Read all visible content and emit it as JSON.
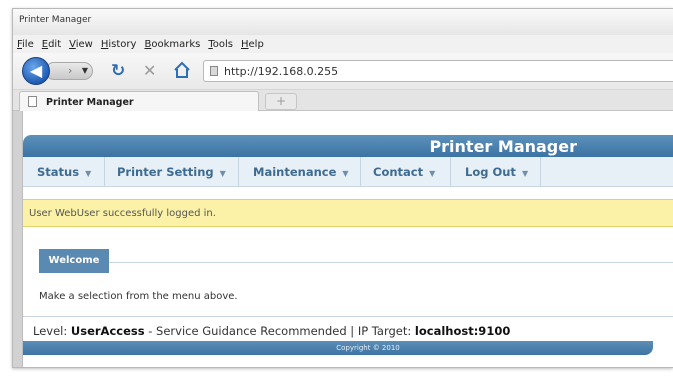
{
  "window": {
    "title": "Printer Manager"
  },
  "menubar": {
    "items": [
      "File",
      "Edit",
      "View",
      "History",
      "Bookmarks",
      "Tools",
      "Help"
    ]
  },
  "navbar": {
    "url": "http://192.168.0.255"
  },
  "tab": {
    "title": "Printer Manager",
    "new_tab": "+"
  },
  "page": {
    "header_title": "Printer Manager",
    "menu": [
      {
        "label": "Status"
      },
      {
        "label": "Printer Setting"
      },
      {
        "label": "Maintenance"
      },
      {
        "label": "Contact"
      },
      {
        "label": "Log Out"
      }
    ],
    "notice": "User WebUser successfully logged in.",
    "welcome_tab": "Welcome",
    "welcome_text": "Make a selection from the menu above.",
    "status": {
      "level_label": "Level:",
      "level_value": "UserAccess",
      "guidance": " - Service Guidance Recommended | IP Target:",
      "target_value": "localhost:9100"
    },
    "footer": "Copyright © 2010"
  },
  "colors": {
    "header_blue": "#3b73a3",
    "menu_bg": "#e8f0f7",
    "notice_bg": "#fbf2a8",
    "link_blue": "#3e6b91"
  }
}
